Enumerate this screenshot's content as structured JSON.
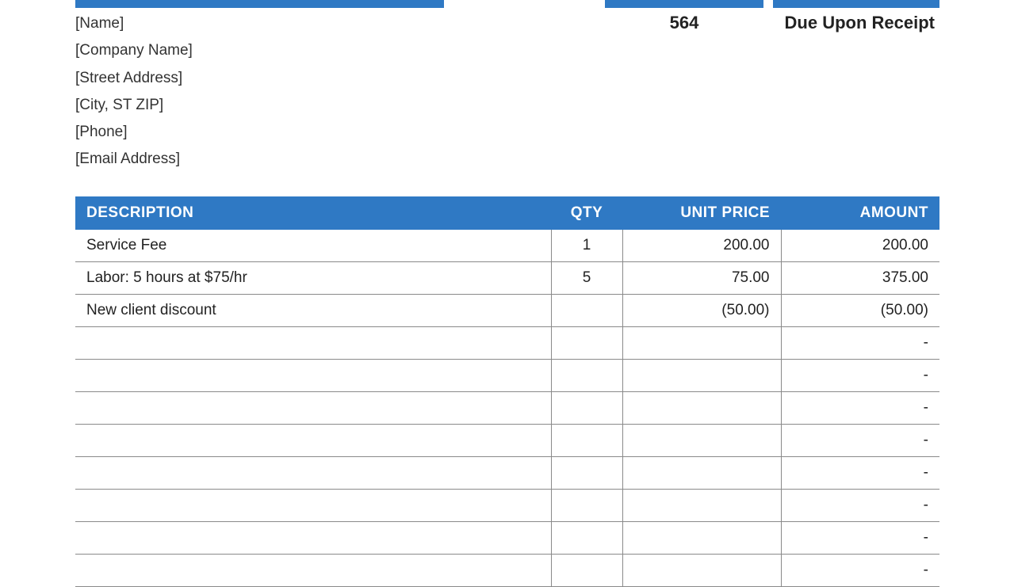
{
  "bill_to": {
    "name": "[Name]",
    "company": "[Company Name]",
    "street": "[Street Address]",
    "city_st_zip": "[City, ST  ZIP]",
    "phone": "[Phone]",
    "email": "[Email Address]"
  },
  "invoice": {
    "number": "564",
    "terms": "Due Upon Receipt"
  },
  "columns": {
    "description": "DESCRIPTION",
    "qty": "QTY",
    "unit_price": "UNIT PRICE",
    "amount": "AMOUNT"
  },
  "lines": [
    {
      "desc": "Service Fee",
      "qty": "1",
      "price": "200.00",
      "amount": "200.00"
    },
    {
      "desc": "Labor: 5 hours at $75/hr",
      "qty": "5",
      "price": "75.00",
      "amount": "375.00"
    },
    {
      "desc": "New client discount",
      "qty": "",
      "price": "(50.00)",
      "amount": "(50.00)"
    },
    {
      "desc": "",
      "qty": "",
      "price": "",
      "amount": "-"
    },
    {
      "desc": "",
      "qty": "",
      "price": "",
      "amount": "-"
    },
    {
      "desc": "",
      "qty": "",
      "price": "",
      "amount": "-"
    },
    {
      "desc": "",
      "qty": "",
      "price": "",
      "amount": "-"
    },
    {
      "desc": "",
      "qty": "",
      "price": "",
      "amount": "-"
    },
    {
      "desc": "",
      "qty": "",
      "price": "",
      "amount": "-"
    },
    {
      "desc": "",
      "qty": "",
      "price": "",
      "amount": "-"
    },
    {
      "desc": "",
      "qty": "",
      "price": "",
      "amount": "-"
    }
  ]
}
